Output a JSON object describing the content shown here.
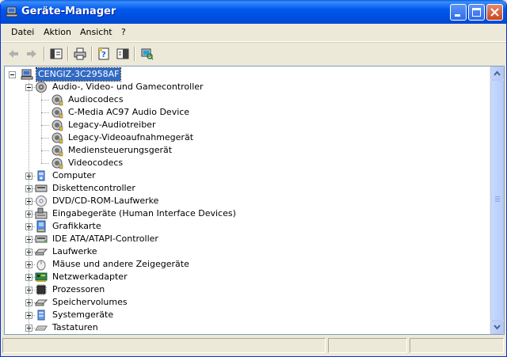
{
  "window": {
    "title": "Geräte-Manager",
    "icon": "device-manager-icon"
  },
  "title_buttons": [
    "minimize-icon",
    "maximize-icon",
    "close-icon"
  ],
  "menu": [
    "Datei",
    "Aktion",
    "Ansicht",
    "?"
  ],
  "toolbar": [
    "back-arrow-icon",
    "forward-arrow-icon",
    "console-tree-icon",
    "print-icon",
    "properties-icon",
    "help-icon",
    "scan-hardware-icon"
  ],
  "tree": {
    "root": "CENGIZ-3C2958AF",
    "groups": [
      {
        "label": "Audio-, Video- und Gamecontroller",
        "icon": "audio-icon",
        "expanded": true,
        "children": [
          "Audiocodecs",
          "C-Media AC97 Audio Device",
          "Legacy-Audiotreiber",
          "Legacy-Videoaufnahmegerät",
          "Mediensteuerungsgerät",
          "Videocodecs"
        ]
      },
      {
        "label": "Computer",
        "icon": "computer-icon"
      },
      {
        "label": "Diskettencontroller",
        "icon": "floppy-controller-icon"
      },
      {
        "label": "DVD/CD-ROM-Laufwerke",
        "icon": "cdrom-icon"
      },
      {
        "label": "Eingabegeräte (Human Interface Devices)",
        "icon": "hid-icon"
      },
      {
        "label": "Grafikkarte",
        "icon": "display-adapter-icon"
      },
      {
        "label": "IDE ATA/ATAPI-Controller",
        "icon": "ide-controller-icon"
      },
      {
        "label": "Laufwerke",
        "icon": "disk-drive-icon"
      },
      {
        "label": "Mäuse und andere Zeigegeräte",
        "icon": "mouse-icon"
      },
      {
        "label": "Netzwerkadapter",
        "icon": "network-adapter-icon"
      },
      {
        "label": "Prozessoren",
        "icon": "processor-icon"
      },
      {
        "label": "Speichervolumes",
        "icon": "storage-volume-icon"
      },
      {
        "label": "Systemgeräte",
        "icon": "system-devices-icon"
      },
      {
        "label": "Tastaturen",
        "icon": "keyboard-icon"
      }
    ]
  },
  "colors": {
    "titlebar": "#0054E3",
    "selection": "#316AC5",
    "window_bg": "#ECE9D8"
  }
}
